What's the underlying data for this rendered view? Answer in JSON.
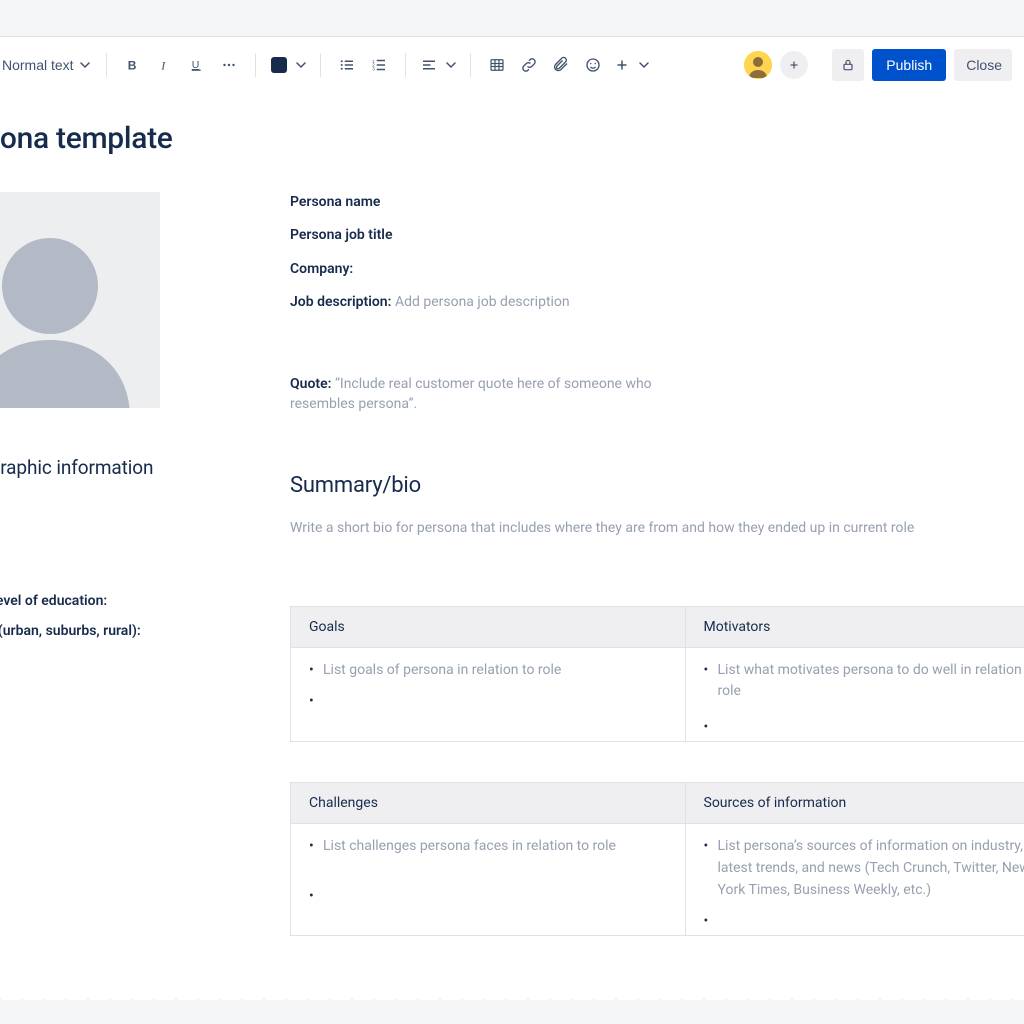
{
  "toolbar": {
    "text_style": "Normal text",
    "publish_label": "Publish",
    "close_label": "Close"
  },
  "page": {
    "title": "Persona template"
  },
  "persona": {
    "fields": {
      "name_label": "Persona name",
      "job_title_label": "Persona job title",
      "company_label": "Company:",
      "job_desc_label": "Job description:",
      "job_desc_placeholder": "Add persona job description",
      "quote_label": "Quote:",
      "quote_placeholder": "“Include real customer quote here of someone who resembles persona”."
    },
    "summary": {
      "heading": "Summary/bio",
      "placeholder": "Write a short bio for persona that includes where they are from and how they ended up in current role"
    },
    "demographic": {
      "heading": "Demographic information",
      "items": [
        "Highest level of education:",
        "Location (urban, suburbs, rural):"
      ]
    },
    "tables": [
      {
        "headers": [
          "Goals",
          "Motivators"
        ],
        "col1_items": [
          "List goals of persona in relation to role",
          ""
        ],
        "col2_items": [
          "List what motivates persona to do well in relation to role",
          ""
        ]
      },
      {
        "headers": [
          "Challenges",
          "Sources of information"
        ],
        "col1_items": [
          "List challenges persona faces in relation to role",
          ""
        ],
        "col2_items": [
          "List persona’s sources of information on industry, latest trends, and news (Tech Crunch, Twitter, New York Times, Business Weekly, etc.)",
          ""
        ]
      }
    ]
  }
}
